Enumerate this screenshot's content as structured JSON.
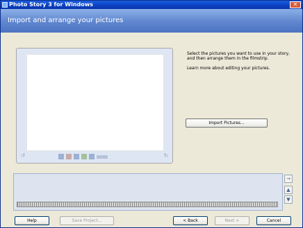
{
  "window": {
    "title": "Photo Story 3 for Windows",
    "close_glyph": "✕"
  },
  "header": {
    "title": "Import and arrange your pictures"
  },
  "instructions": {
    "line1": "Select the pictures you want to use in your story, and then arrange them in the filmstrip.",
    "line2": "Learn more about editing your pictures."
  },
  "buttons": {
    "import_pictures": "Import Pictures...",
    "help": "Help",
    "view_project": "Save Project...",
    "back": "< Back",
    "next": "Next >",
    "cancel": "Cancel"
  },
  "icons": {
    "rotate_left": "↺",
    "rotate_right": "↻",
    "move_right": "→",
    "move_up": "▲",
    "move_down": "▼"
  }
}
